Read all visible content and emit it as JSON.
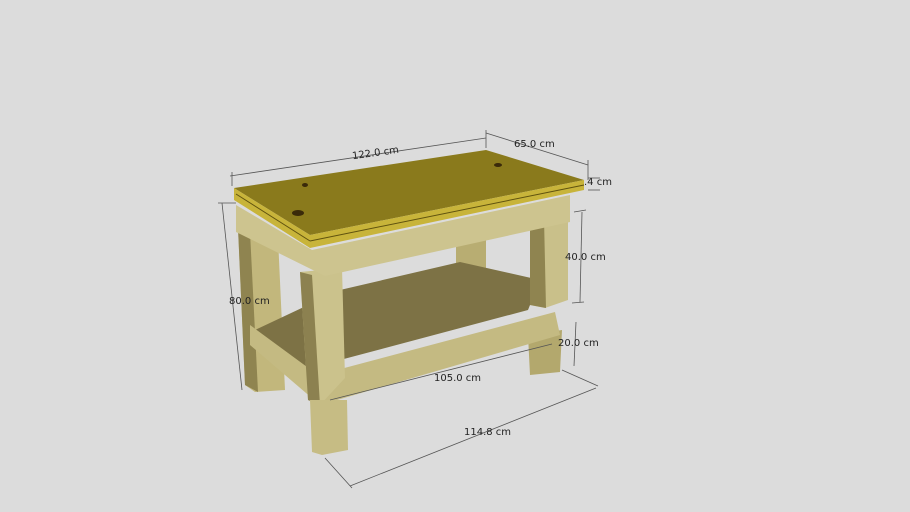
{
  "colors": {
    "background": "#dcdcdc",
    "top": "#8a7a1c",
    "top_edge": "#c8b43a",
    "wood_light": "#c9c08a",
    "wood_mid": "#a89c62",
    "wood_dark": "#6e6638",
    "shelf": "#7d7245",
    "dimension_line": "#555555"
  },
  "dimensions": {
    "length": "122.0 cm",
    "width": "65.0 cm",
    "top_thickness": ".4 cm",
    "height": "80.0 cm",
    "upper_leg": "40.0 cm",
    "lower_leg": "20.0 cm",
    "shelf_length": "105.0 cm",
    "base_length": "114.8 cm"
  }
}
